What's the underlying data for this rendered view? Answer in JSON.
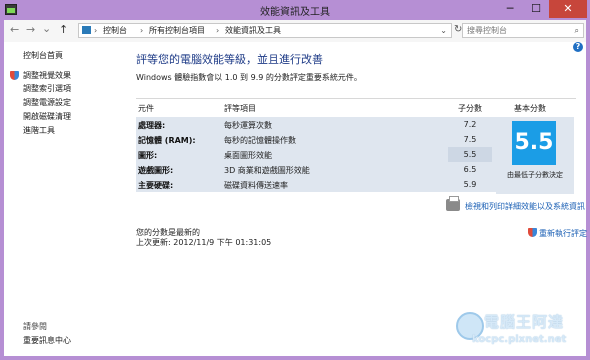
{
  "window": {
    "title": "效能資訊及工具",
    "minimize": "─",
    "maximize": "☐",
    "close": "✕"
  },
  "navbar": {
    "back": "←",
    "forward": "→",
    "history": "⌄",
    "up": "↑",
    "breadcrumbs": [
      "控制台",
      "所有控制台項目",
      "效能資訊及工具"
    ],
    "separator": "›",
    "search_placeholder": "搜尋控制台"
  },
  "sidebar": {
    "home": "控制台首頁",
    "items": [
      "調整視覺效果",
      "調整索引選項",
      "調整電源設定",
      "開啟磁碟清理",
      "進階工具"
    ],
    "see_also_title": "請參閱",
    "see_also_link": "重要訊息中心"
  },
  "main": {
    "heading": "評等您的電腦效能等級，並且進行改善",
    "description": "Windows 體驗指數會以 1.0 到 9.9 的分數評定重要系統元件。",
    "table": {
      "headers": {
        "component": "元件",
        "rated": "評等項目",
        "subscore": "子分數",
        "basescore": "基本分數"
      },
      "rows": [
        {
          "component": "處理器:",
          "rated": "每秒運算次數",
          "subscore": "7.2"
        },
        {
          "component": "記憶體 (RAM):",
          "rated": "每秒的記憶體操作數",
          "subscore": "7.5"
        },
        {
          "component": "圖形:",
          "rated": "桌面圖形效能",
          "subscore": "5.5"
        },
        {
          "component": "遊戲圖形:",
          "rated": "3D 商業和遊戲圖形效能",
          "subscore": "6.5"
        },
        {
          "component": "主要硬碟:",
          "rated": "磁碟資料傳送速率",
          "subscore": "5.9"
        }
      ],
      "base_score": "5.5",
      "base_note": "由最低子分數決定"
    },
    "print_link": "檢視和列印詳細效能以及系統資訊",
    "status_current": "您的分數是最新的",
    "status_updated": "上次更新: 2012/11/9 下午 01:31:05",
    "rerun": "重新執行評定"
  },
  "watermark": {
    "title": "電腦王阿達",
    "url": "kocpc.pixnet.net"
  },
  "colors": {
    "window_frame": "#b68fd4",
    "heading": "#1e3b87",
    "score_tile": "#1b9de6",
    "table_row": "#dfe6ef",
    "link": "#1a5fb4",
    "close_button": "#c7463b"
  }
}
